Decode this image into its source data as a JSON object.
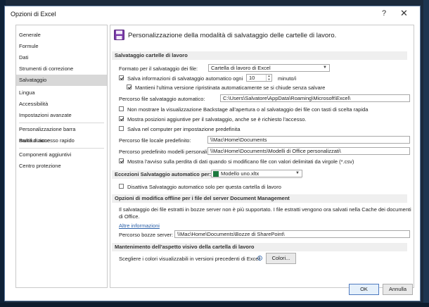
{
  "window": {
    "title": "Opzioni di Excel",
    "help_glyph": "?",
    "close_glyph": "✕"
  },
  "nav": {
    "items": [
      "Generale",
      "Formule",
      "Dati",
      "Strumenti di correzione",
      "Salvataggio",
      "Lingua",
      "Accessibilità",
      "Impostazioni avanzate",
      "Personalizzazione barra multifunzione",
      "Barra di accesso rapido",
      "Componenti aggiuntivi",
      "Centro protezione"
    ],
    "selected": "Salvataggio"
  },
  "header": {
    "title": "Personalizzazione della modalità di salvataggio delle cartelle di lavoro."
  },
  "save_section": {
    "title": "Salvataggio cartelle di lavoro",
    "format_label": "Formato per il salvataggio dei file:",
    "format_value": "Cartella di lavoro di Excel",
    "autosave_label": "Salva informazioni di salvataggio automatico ogni",
    "autosave_minutes": "10",
    "minutes_unit": "minuto/i",
    "keep_last_label": "Mantieni l'ultima versione ripristinata automaticamente se si chiude senza salvare",
    "autorecover_path_label": "Percorso file salvataggio automatico:",
    "autorecover_path": "C:\\Users\\Salvatore\\AppData\\Roaming\\Microsoft\\Excel\\",
    "backstage_label": "Non mostrare la visualizzazione Backstage all'apertura o al salvataggio dei file con tasti di scelta rapida",
    "show_locations_label": "Mostra posizioni aggiuntive per il salvataggio, anche se è richiesto l'accesso.",
    "save_local_label": "Salva nel computer per impostazione predefinita",
    "local_path_label": "Percorso file locale predefinito:",
    "local_path": "\\\\Mac\\Home\\Documents",
    "templates_path_label": "Percorso predefinito modelli personali:",
    "templates_path": "\\\\Mac\\Home\\Documents\\Modelli di Office personalizzati\\",
    "csv_warning_label": "Mostra l'avviso sulla perdita di dati quando si modificano file con valori delimitati da virgole (*.csv)"
  },
  "exceptions_section": {
    "title": "Eccezioni Salvataggio automatico per:",
    "workbook": "Modello uno.xltx",
    "disable_label": "Disattiva Salvataggio automatico solo per questa cartella di lavoro"
  },
  "offline_section": {
    "title": "Opzioni di modifica offline per i file del server Document Management",
    "info_line1": "Il salvataggio dei file estratti in bozze server non è più supportato. I file estratti vengono ora salvati nella Cache dei documenti",
    "info_line2": "di Office.",
    "more_info": "Altre informazioni",
    "drafts_label": "Percorso bozze server:",
    "drafts_path": "\\\\Mac\\Home\\Documents\\Bozze di SharePoint\\"
  },
  "appearance_section": {
    "title": "Mantenimento dell'aspetto visivo della cartella di lavoro",
    "colors_label": "Scegliere i colori visualizzabili in versioni precedenti di Excel:",
    "colors_button": "Colori..."
  },
  "footer": {
    "ok": "OK",
    "cancel": "Annulla"
  },
  "colors": {
    "accent": "#4f7ac0",
    "selected_nav": "#d8d8d8",
    "section_bg": "#efefef",
    "excel_green": "#1d7a3f",
    "header_icon": "#7a3aa8"
  }
}
